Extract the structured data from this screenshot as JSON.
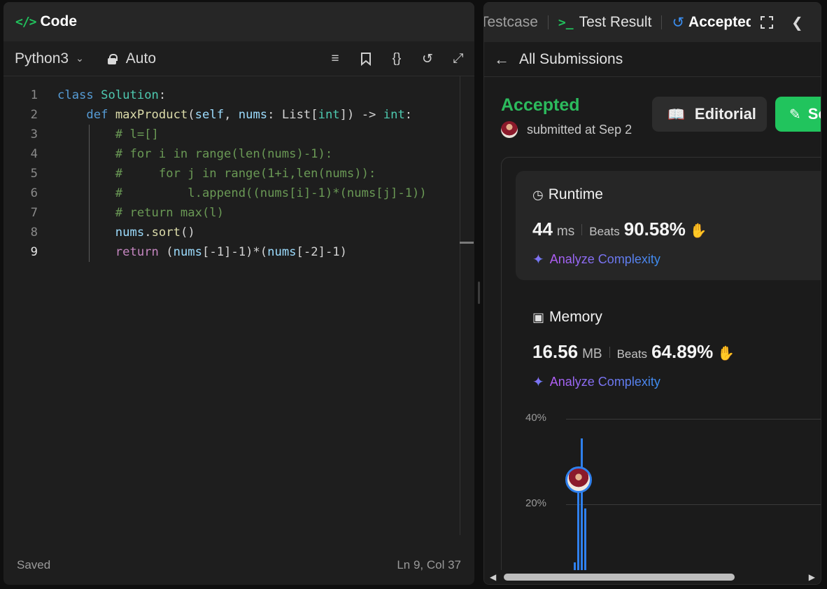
{
  "code_panel": {
    "title": "Code",
    "language": "Python3",
    "mode": "Auto",
    "lines": [
      {
        "n": "1",
        "text": "class Solution:"
      },
      {
        "n": "2",
        "text": "    def maxProduct(self, nums: List[int]) -> int:"
      },
      {
        "n": "3",
        "text": "        # l=[]"
      },
      {
        "n": "4",
        "text": "        # for i in range(len(nums)-1):"
      },
      {
        "n": "5",
        "text": "        #     for j in range(1+i,len(nums)):"
      },
      {
        "n": "6",
        "text": "        #         l.append((nums[i]-1)*(nums[j]-1))"
      },
      {
        "n": "7",
        "text": "        # return max(l)"
      },
      {
        "n": "8",
        "text": "        nums.sort()"
      },
      {
        "n": "9",
        "text": "        return (nums[-1]-1)*(nums[-2]-1)"
      }
    ],
    "status": "Saved",
    "cursor": "Ln 9, Col 37"
  },
  "result_panel": {
    "tabs": {
      "testcase": "Testcase",
      "test_result": "Test Result",
      "accepted": "Accepted"
    },
    "back_label": "All Submissions",
    "status": "Accepted",
    "submitted_text": "submitted at Sep 2",
    "editorial_label": "Editorial",
    "solution_label": "Solution",
    "runtime": {
      "title": "Runtime",
      "value": "44",
      "unit": "ms",
      "beats_label": "Beats",
      "beats_value": "90.58%",
      "analyze_label": "Analyze Complexity"
    },
    "memory": {
      "title": "Memory",
      "value": "16.56",
      "unit": "MB",
      "beats_label": "Beats",
      "beats_value": "64.89%",
      "analyze_label": "Analyze Complexity"
    }
  },
  "icons": {
    "code": "code-brackets-icon",
    "terminal": "terminal-icon",
    "history": "history-icon",
    "clock": "clock-icon",
    "chip": "chip-icon",
    "clap": "clap-icon",
    "sparkle": "sparkle-icon"
  },
  "colors": {
    "accent_green": "#2cbb5d",
    "accent_blue": "#2f80ed",
    "bg": "#1e1e1e"
  },
  "chart_data": {
    "type": "bar",
    "yticks": [
      "40%",
      "20%"
    ],
    "ylim": [
      0,
      40
    ],
    "values": [
      3,
      21,
      35,
      17
    ]
  }
}
